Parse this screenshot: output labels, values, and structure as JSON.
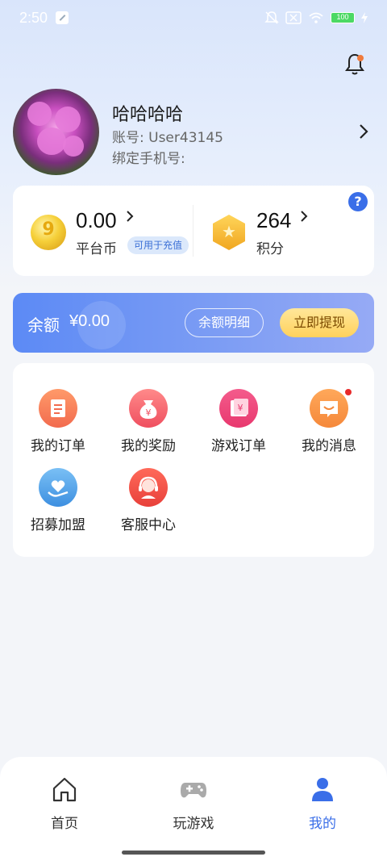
{
  "status_bar": {
    "time": "2:50",
    "battery": "100"
  },
  "profile": {
    "name": "哈哈哈哈",
    "account": "账号: User43145",
    "phone": "绑定手机号:"
  },
  "wallet": {
    "coin_value": "0.00",
    "coin_label": "平台币",
    "coin_badge": "可用于充值",
    "points_value": "264",
    "points_label": "积分",
    "help": "?"
  },
  "balance": {
    "label": "余额",
    "value": "¥0.00",
    "detail_button": "余额明细",
    "withdraw_button": "立即提现"
  },
  "menu": {
    "items": [
      {
        "label": "我的订单",
        "icon": "order-icon",
        "color": "#f26b4e"
      },
      {
        "label": "我的奖励",
        "icon": "reward-bag-icon",
        "color": "#ef4f5f"
      },
      {
        "label": "游戏订单",
        "icon": "game-order-icon",
        "color": "#e8386e"
      },
      {
        "label": "我的消息",
        "icon": "message-icon",
        "color": "#f5883a"
      },
      {
        "label": "招募加盟",
        "icon": "recruit-heart-icon",
        "color": "#3d8fe0"
      },
      {
        "label": "客服中心",
        "icon": "customer-service-icon",
        "color": "#e8403a"
      }
    ]
  },
  "tabs": [
    {
      "label": "首页",
      "icon": "home-icon"
    },
    {
      "label": "玩游戏",
      "icon": "gamepad-icon"
    },
    {
      "label": "我的",
      "icon": "profile-icon"
    }
  ],
  "colors": {
    "accent": "#3a6ee8",
    "banner_start": "#5c8af5",
    "withdraw": "#ffd15c"
  }
}
